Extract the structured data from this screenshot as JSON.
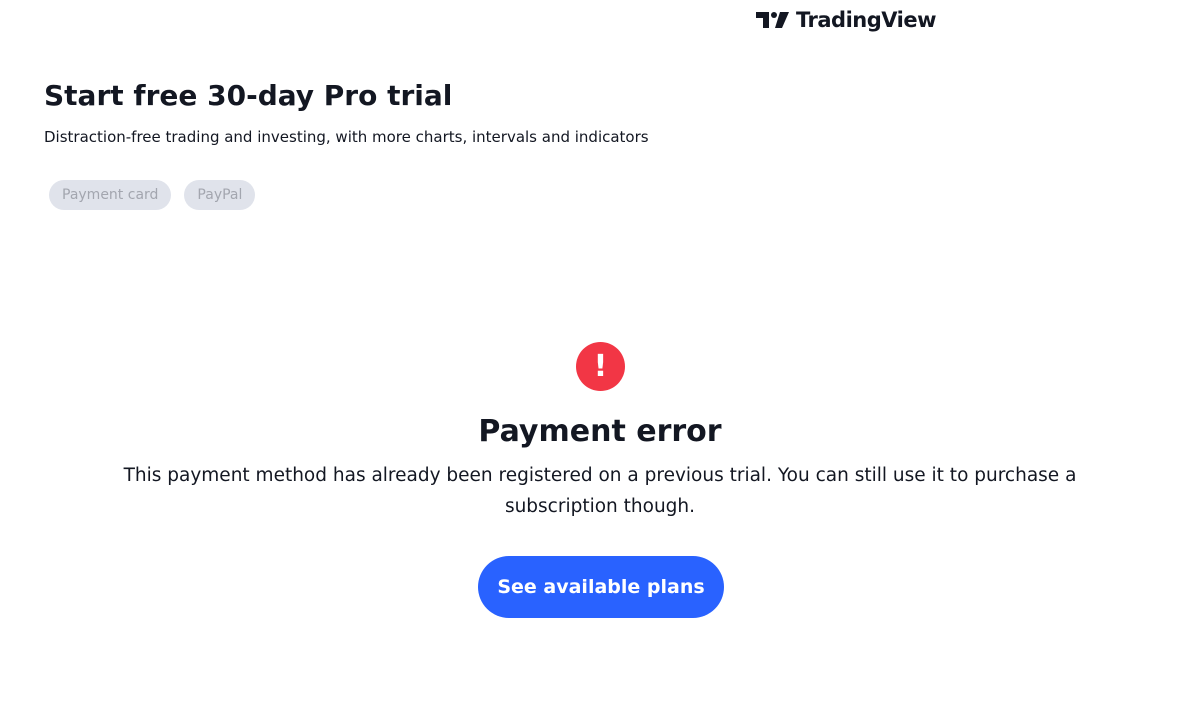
{
  "header": {
    "brand_name": "TradingView",
    "logo_icon": "tradingview-logo-icon"
  },
  "trial": {
    "title": "Start free 30-day Pro trial",
    "subtitle": "Distraction-free trading and investing, with more charts, intervals and indicators"
  },
  "payment_tabs": [
    {
      "label": "Payment card",
      "state": "disabled"
    },
    {
      "label": "PayPal",
      "state": "disabled"
    }
  ],
  "error": {
    "icon": "exclamation-icon",
    "icon_glyph": "!",
    "title": "Payment error",
    "message": "This payment method has already been registered on a previous trial. You can still use it to purchase a subscription though."
  },
  "actions": {
    "see_plans_label": "See available plans"
  },
  "colors": {
    "accent": "#2962ff",
    "error": "#f23645",
    "tab_background": "#e0e3eb",
    "tab_text": "#a3a6af",
    "text": "#131722"
  }
}
